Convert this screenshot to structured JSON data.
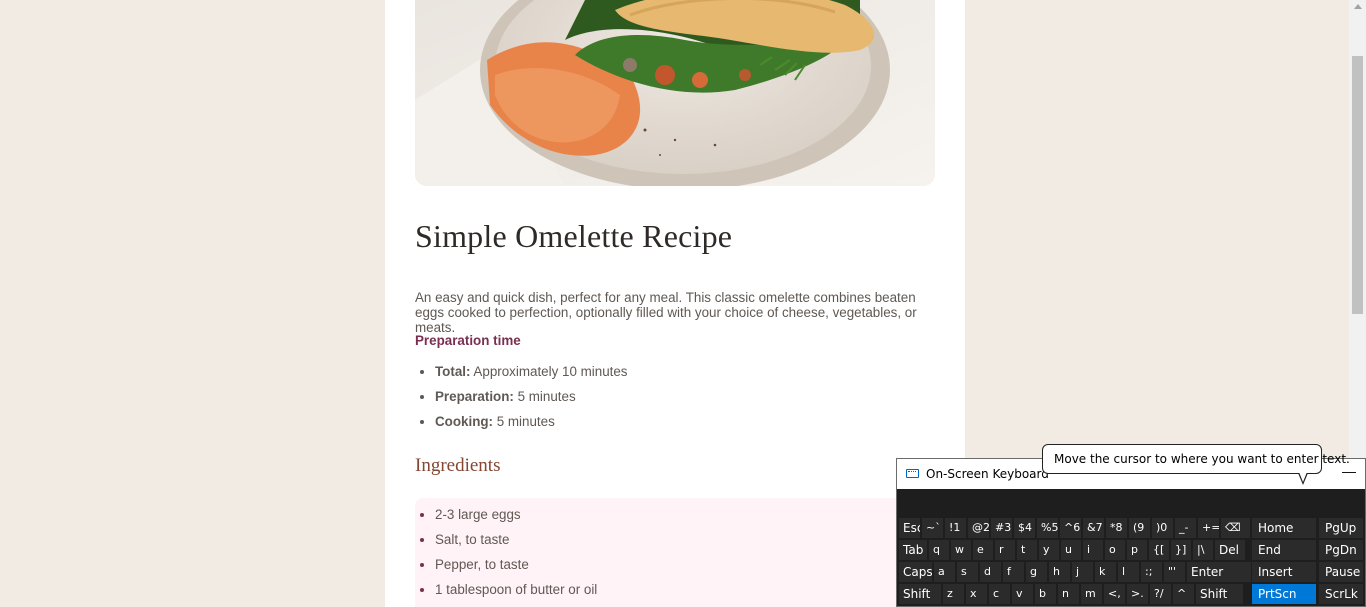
{
  "recipe": {
    "title": "Simple Omelette Recipe",
    "description": "An easy and quick dish, perfect for any meal. This classic omelette combines beaten eggs cooked to perfection, optionally filled with your choice of cheese, vegetables, or meats.",
    "preparation": {
      "heading": "Preparation time",
      "items": [
        {
          "label": "Total:",
          "value": " Approximately 10 minutes"
        },
        {
          "label": "Preparation:",
          "value": " 5 minutes"
        },
        {
          "label": "Cooking:",
          "value": " 5 minutes"
        }
      ]
    },
    "ingredients": {
      "heading": "Ingredients",
      "items": [
        "2-3 large eggs",
        "Salt, to taste",
        "Pepper, to taste",
        "1 tablespoon of butter or oil"
      ]
    },
    "image_subject": "omelette-plate-image"
  },
  "osk": {
    "title": "On-Screen Keyboard",
    "minimize_label": "—",
    "tooltip": "Move the cursor to where you want to enter text.",
    "row1": [
      "Esc",
      "~`",
      "!1",
      "@2",
      "#3",
      "$4",
      "%5",
      "^6",
      "&7",
      "*8",
      "(9",
      ")0",
      "_-",
      "+=",
      "⌫",
      "Home",
      "PgUp"
    ],
    "row2": [
      "Tab",
      "q",
      "w",
      "e",
      "r",
      "t",
      "y",
      "u",
      "i",
      "o",
      "p",
      "{[",
      "}]",
      "|\\",
      "Del",
      "End",
      "PgDn"
    ],
    "row3": [
      "Caps",
      "a",
      "s",
      "d",
      "f",
      "g",
      "h",
      "j",
      "k",
      "l",
      ":;",
      "\"'",
      "Enter",
      "Insert",
      "Pause"
    ],
    "row4": [
      "Shift",
      "z",
      "x",
      "c",
      "v",
      "b",
      "n",
      "m",
      "<,",
      ">.",
      "?/",
      "^",
      "Shift",
      "PrtScn",
      "ScrLk"
    ],
    "highlight_key": "PrtScn",
    "accent_color": "#0078d7"
  },
  "colors": {
    "page_bg": "#f2ebe3",
    "heading_accent": "#7a2f50",
    "ingredients_heading": "#854632",
    "ingredients_bg": "#fff3f8"
  }
}
